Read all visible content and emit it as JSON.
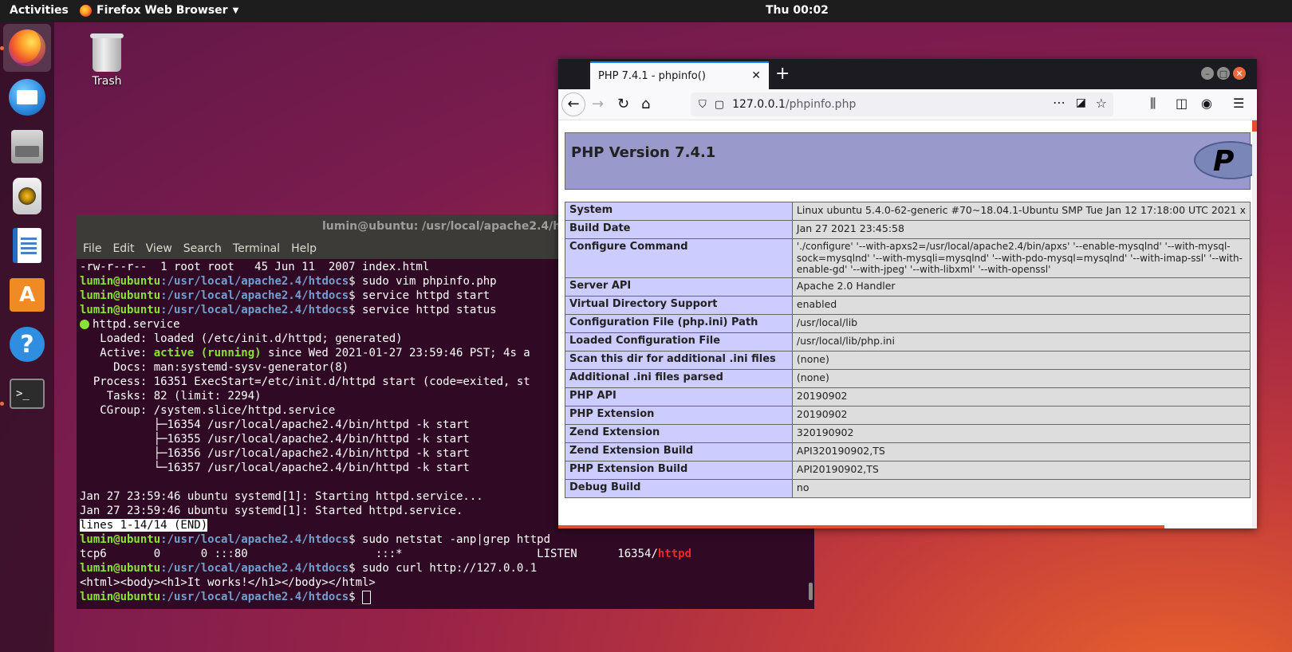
{
  "topbar": {
    "activities": "Activities",
    "app_name": "Firefox Web Browser",
    "clock": "Thu 00:02"
  },
  "dock": {
    "items": [
      "firefox-icon",
      "thunderbird-icon",
      "files-icon",
      "rhythmbox-icon",
      "libreoffice-writer-icon",
      "software-center-icon",
      "help-icon",
      "terminal-icon"
    ],
    "terminal_glyph": ">_",
    "store_glyph": "A",
    "help_glyph": "?"
  },
  "desktop": {
    "trash_label": "Trash"
  },
  "terminal": {
    "title": "lumin@ubuntu: /usr/local/apache2.4/htdocs",
    "menu": [
      "File",
      "Edit",
      "View",
      "Search",
      "Terminal",
      "Help"
    ],
    "prompt_user": "lumin@ubuntu",
    "prompt_path": ":/usr/local/apache2.4/htdocs",
    "prompt_sym": "$ ",
    "line_ls": "-rw-r--r--  1 root root   45 Jun 11  2007 index.html",
    "cmd_vim": "sudo vim phpinfo.php",
    "cmd_start": "service httpd start",
    "cmd_status": "service httpd status",
    "svc_name": "httpd.service",
    "loaded": "   Loaded: loaded (/etc/init.d/httpd; generated)",
    "active_label": "   Active: ",
    "active_state": "active (running)",
    "active_rest": " since Wed 2021-01-27 23:59:46 PST; 4s a",
    "docs": "     Docs: man:systemd-sysv-generator(8)",
    "process": "  Process: 16351 ExecStart=/etc/init.d/httpd start (code=exited, st",
    "tasks": "    Tasks: 82 (limit: 2294)",
    "cgroup": "   CGroup: /system.slice/httpd.service",
    "proc1": "           ├─16354 /usr/local/apache2.4/bin/httpd -k start",
    "proc2": "           ├─16355 /usr/local/apache2.4/bin/httpd -k start",
    "proc3": "           ├─16356 /usr/local/apache2.4/bin/httpd -k start",
    "proc4": "           └─16357 /usr/local/apache2.4/bin/httpd -k start",
    "log1": "Jan 27 23:59:46 ubuntu systemd[1]: Starting httpd.service...",
    "log2": "Jan 27 23:59:46 ubuntu systemd[1]: Started httpd.service.",
    "pager": "lines 1-14/14 (END)",
    "cmd_netstat": "sudo netstat -anp|grep httpd",
    "netstat_line": "tcp6       0      0 :::80                   :::*                    LISTEN      16354/",
    "netstat_proc": "httpd",
    "cmd_curl": "sudo curl http://127.0.0.1",
    "curl_output": "<html><body><h1>It works!</h1></body></html>"
  },
  "browser": {
    "tab_title": "PHP 7.4.1 - phpinfo()",
    "url_host": "127.0.0.1",
    "url_path": "/phpinfo.php",
    "php_version": "PHP Version 7.4.1",
    "php_logo_text": "P",
    "rows": [
      {
        "k": "System",
        "v": "Linux ubuntu 5.4.0-62-generic #70~18.04.1-Ubuntu SMP Tue Jan 12 17:18:00 UTC 2021 x"
      },
      {
        "k": "Build Date",
        "v": "Jan 27 2021 23:45:58"
      },
      {
        "k": "Configure Command",
        "v": "'./configure' '--with-apxs2=/usr/local/apache2.4/bin/apxs' '--enable-mysqlnd' '--with-mysql-sock=mysqlnd' '--with-mysqli=mysqlnd' '--with-pdo-mysql=mysqlnd' '--with-imap-ssl' '--with-enable-gd' '--with-jpeg' '--with-libxml' '--with-openssl'"
      },
      {
        "k": "Server API",
        "v": "Apache 2.0 Handler"
      },
      {
        "k": "Virtual Directory Support",
        "v": "enabled"
      },
      {
        "k": "Configuration File (php.ini) Path",
        "v": "/usr/local/lib"
      },
      {
        "k": "Loaded Configuration File",
        "v": "/usr/local/lib/php.ini"
      },
      {
        "k": "Scan this dir for additional .ini files",
        "v": "(none)"
      },
      {
        "k": "Additional .ini files parsed",
        "v": "(none)"
      },
      {
        "k": "PHP API",
        "v": "20190902"
      },
      {
        "k": "PHP Extension",
        "v": "20190902"
      },
      {
        "k": "Zend Extension",
        "v": "320190902"
      },
      {
        "k": "Zend Extension Build",
        "v": "API320190902,TS"
      },
      {
        "k": "PHP Extension Build",
        "v": "API20190902,TS"
      },
      {
        "k": "Debug Build",
        "v": "no"
      }
    ]
  }
}
